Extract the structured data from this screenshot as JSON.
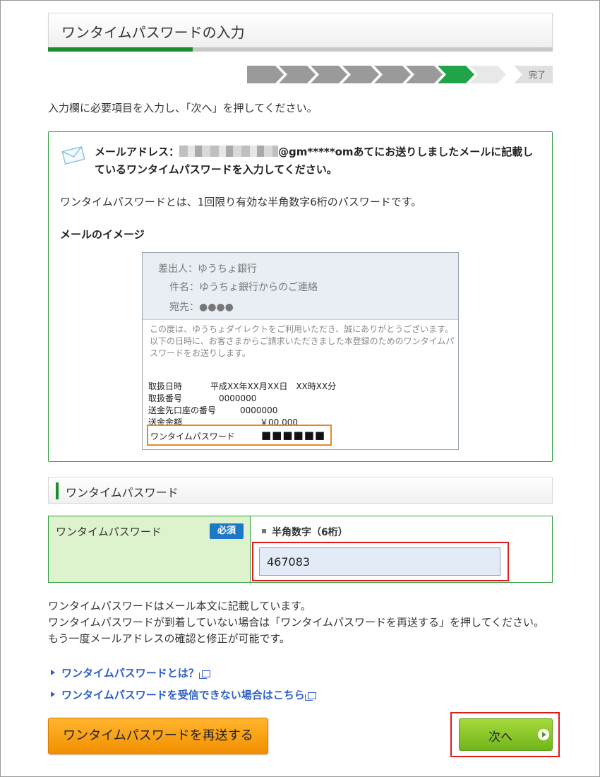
{
  "page": {
    "title": "ワンタイムパスワードの入力",
    "step_total": 8,
    "step_current": 7,
    "step_end_label": "完了",
    "intro": "入力欄に必要項目を入力し、「次へ」を押してください。"
  },
  "mail_info": {
    "prefix": "メールアドレス：",
    "address_suffix": "@gm*****om",
    "message_rest": "あてにお送りしましたメールに記載しているワンタイムパスワードを入力してください。",
    "description": "ワンタイムパスワードとは、1回限り有効な半角数字6桁のパスワードです。",
    "image_title": "メールのイメージ"
  },
  "sample_mail": {
    "sender": "差出人：ゆうちょ銀行",
    "subject": "件名：ゆうちょ銀行からのご連絡",
    "recipient": "宛先：●●●●",
    "body_line1": "この度は、ゆうちょダイレクトをご利用いただき、誠にありがとうございます。",
    "body_line2": "以下の日時に、お客さまからご請求いただきました本登録のためのワンタイムパスワードをお送りします。",
    "fields": [
      {
        "label": "取扱日時",
        "value": "平成XX年XX月XX日　XX時XX分"
      },
      {
        "label": "取扱番号",
        "value": "0000000"
      },
      {
        "label": "送金先口座の番号",
        "value": "0000000"
      },
      {
        "label": "送金金額",
        "value": "￥00,000"
      }
    ],
    "otp_label": "ワンタイムパスワード",
    "otp_value": "■■■■■■"
  },
  "section": {
    "title": "ワンタイムパスワード"
  },
  "form": {
    "label": "ワンタイムパスワード",
    "required": "必須",
    "hint": "半角数字（6桁）",
    "value": "467083"
  },
  "notes": {
    "line1": "ワンタイムパスワードはメール本文に記載しています。",
    "line2": "ワンタイムパスワードが到着していない場合は「ワンタイムパスワードを再送する」を押してください。もう一度メールアドレスの確認と修正が可能です。"
  },
  "links": {
    "what_is": "ワンタイムパスワードとは？",
    "cannot_receive": "ワンタイムパスワードを受信できない場合はこちら"
  },
  "buttons": {
    "resend": "ワンタイムパスワードを再送する",
    "next": "次へ"
  },
  "colors": {
    "accent_green": "#1b8c2c",
    "link_blue": "#2d5fc7",
    "highlight_red": "#e21a1a",
    "resend_orange": "#f28f00",
    "next_green": "#70b51c"
  },
  "icons": {
    "mail": "envelope-icon",
    "external": "external-window-icon",
    "next_arrow": "arrow-right-circle-icon"
  }
}
